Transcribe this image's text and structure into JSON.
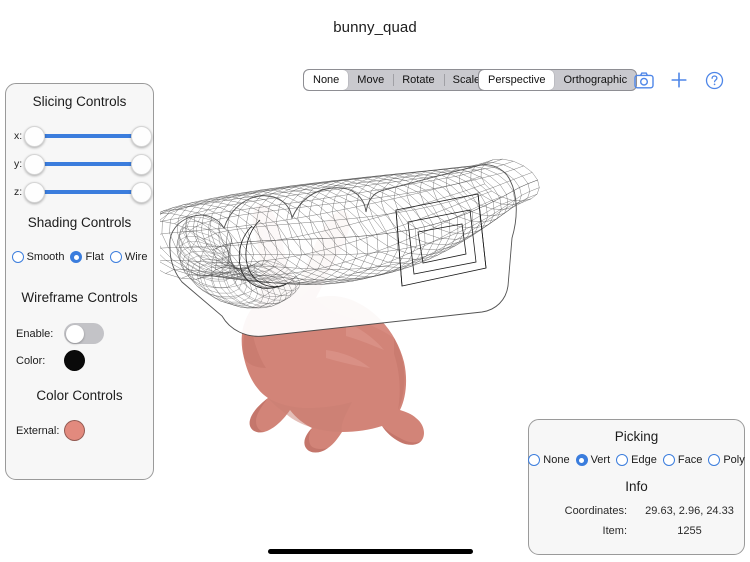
{
  "document": {
    "title": "bunny_quad"
  },
  "toolbar": {
    "transform_modes": [
      {
        "label": "None",
        "selected": true
      },
      {
        "label": "Move",
        "selected": false
      },
      {
        "label": "Rotate",
        "selected": false
      },
      {
        "label": "Scale",
        "selected": false
      }
    ],
    "projection_modes": [
      {
        "label": "Perspective",
        "selected": true
      },
      {
        "label": "Orthographic",
        "selected": false
      }
    ],
    "icons": {
      "camera": "camera-icon",
      "add": "plus-icon",
      "help": "question-circle-icon"
    },
    "icon_color": "#4e86e8"
  },
  "slicing": {
    "title": "Slicing Controls",
    "axes": [
      {
        "label": "x:",
        "min": 0,
        "max": 100,
        "low": 0,
        "high": 100
      },
      {
        "label": "y:",
        "min": 0,
        "max": 100,
        "low": 0,
        "high": 100
      },
      {
        "label": "z:",
        "min": 0,
        "max": 100,
        "low": 0,
        "high": 100
      }
    ],
    "track_color": "#3b7ddd"
  },
  "shading": {
    "title": "Shading Controls",
    "options": [
      {
        "label": "Smooth",
        "selected": false
      },
      {
        "label": "Flat",
        "selected": true
      },
      {
        "label": "Wire",
        "selected": false
      }
    ]
  },
  "wireframe": {
    "title": "Wireframe Controls",
    "enable_label": "Enable:",
    "enable_value": false,
    "color_label": "Color:",
    "color_value": "#0a0a0a"
  },
  "color_controls": {
    "title": "Color Controls",
    "external_label": "External:",
    "external_value": "#e28a7e"
  },
  "picking": {
    "title": "Picking",
    "options": [
      {
        "label": "None",
        "selected": false
      },
      {
        "label": "Vert",
        "selected": true
      },
      {
        "label": "Edge",
        "selected": false
      },
      {
        "label": "Face",
        "selected": false
      },
      {
        "label": "Poly",
        "selected": false
      }
    ]
  },
  "info": {
    "title": "Info",
    "rows": [
      {
        "key": "Coordinates:",
        "value": "29.63, 2.96, 24.33"
      },
      {
        "key": "Item:",
        "value": "1255"
      }
    ]
  },
  "viewport": {
    "solid_mesh_color": "#d28478",
    "wire_mesh_color": "#3a3a3a",
    "background": "#ffffff"
  }
}
